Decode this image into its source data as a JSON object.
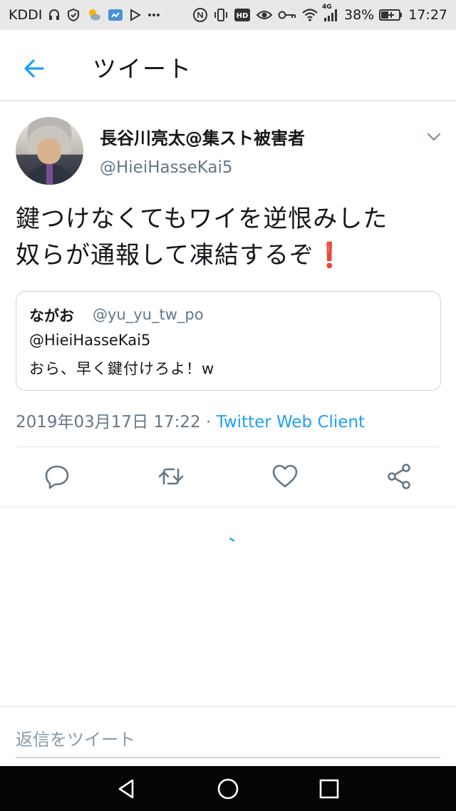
{
  "status_bar": {
    "carrier": "KDDI",
    "battery": "38%",
    "time": "17:27",
    "network": "4G",
    "icons_left": [
      "headset-icon",
      "shield-icon",
      "weather-icon",
      "cloud-icon",
      "play-store-icon",
      "more-icon"
    ],
    "icons_right": [
      "nfc-icon",
      "vibrate-icon",
      "hd-icon",
      "eye-icon",
      "key-icon",
      "wifi-icon",
      "signal-icon",
      "battery-icon"
    ]
  },
  "header": {
    "title": "ツイート"
  },
  "tweet": {
    "display_name": "長谷川亮太@集スト被害者",
    "screen_name": "@HieiHasseKai5",
    "text_line1": "鍵つけなくてもワイを逆恨みした",
    "text_line2": "奴らが通報して凍結するぞ",
    "emoji": "❗",
    "quote": {
      "name": "ながお",
      "handle": "@yu_yu_tw_po",
      "line1": "@HieiHasseKai5",
      "line2": "おら、早く鍵付けろよ！w"
    },
    "timestamp": "2019年03月17日 17:22",
    "separator": " · ",
    "client": "Twitter Web Client"
  },
  "reply": {
    "placeholder": "返信をツイート"
  },
  "colors": {
    "accent": "#1da1f2",
    "secondary_text": "#657786",
    "border": "#e1e8ed"
  }
}
